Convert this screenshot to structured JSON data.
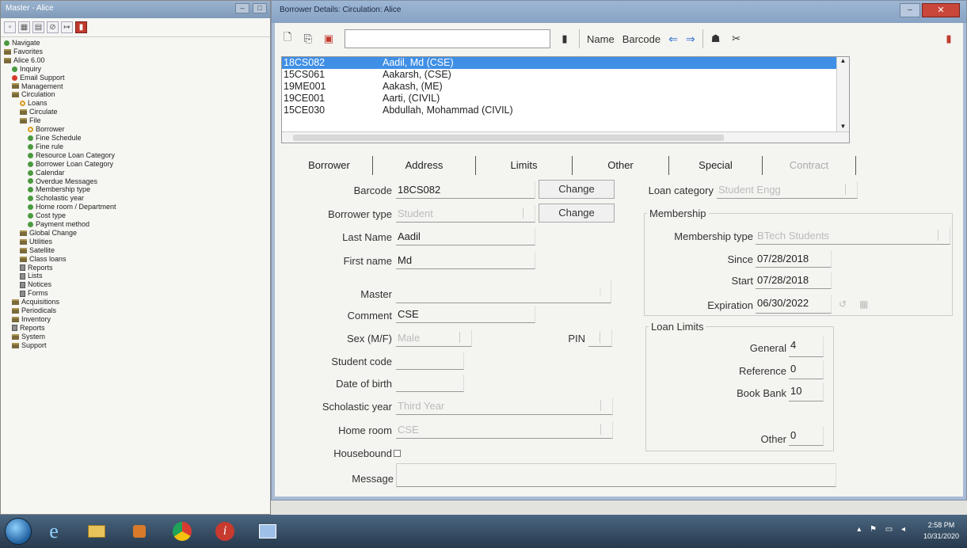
{
  "master": {
    "title": "Master - Alice",
    "tree": [
      {
        "label": "Navigate",
        "icon": "green",
        "level": 0
      },
      {
        "label": "Favorites",
        "icon": "folder",
        "level": 0
      },
      {
        "label": "Alice 6.00",
        "icon": "folder",
        "level": 0
      },
      {
        "label": "Inquiry",
        "icon": "green",
        "level": 1
      },
      {
        "label": "Email Support",
        "icon": "red",
        "level": 1
      },
      {
        "label": "Management",
        "icon": "folder",
        "level": 1
      },
      {
        "label": "Circulation",
        "icon": "folder",
        "level": 1
      },
      {
        "label": "Loans",
        "icon": "ring",
        "level": 2
      },
      {
        "label": "Circulate",
        "icon": "folder",
        "level": 2
      },
      {
        "label": "File",
        "icon": "folder",
        "level": 2
      },
      {
        "label": "Borrower",
        "icon": "ring",
        "level": 3
      },
      {
        "label": "Fine Schedule",
        "icon": "green",
        "level": 3
      },
      {
        "label": "Fine rule",
        "icon": "green",
        "level": 3
      },
      {
        "label": "Resource Loan Category",
        "icon": "green",
        "level": 3
      },
      {
        "label": "Borrower Loan Category",
        "icon": "green",
        "level": 3
      },
      {
        "label": "Calendar",
        "icon": "green",
        "level": 3
      },
      {
        "label": "Overdue Messages",
        "icon": "green",
        "level": 3
      },
      {
        "label": "Membership type",
        "icon": "green",
        "level": 3
      },
      {
        "label": "Scholastic year",
        "icon": "green",
        "level": 3
      },
      {
        "label": "Home room / Department",
        "icon": "green",
        "level": 3
      },
      {
        "label": "Cost type",
        "icon": "green",
        "level": 3
      },
      {
        "label": "Payment method",
        "icon": "green",
        "level": 3
      },
      {
        "label": "Global Change",
        "icon": "folder",
        "level": 2
      },
      {
        "label": "Utilities",
        "icon": "folder",
        "level": 2
      },
      {
        "label": "Satellite",
        "icon": "folder",
        "level": 2
      },
      {
        "label": "Class loans",
        "icon": "folder",
        "level": 2
      },
      {
        "label": "Reports",
        "icon": "doc",
        "level": 2
      },
      {
        "label": "Lists",
        "icon": "doc",
        "level": 2
      },
      {
        "label": "Notices",
        "icon": "doc",
        "level": 2
      },
      {
        "label": "Forms",
        "icon": "doc",
        "level": 2
      },
      {
        "label": "Acquisitions",
        "icon": "folder",
        "level": 1
      },
      {
        "label": "Periodicals",
        "icon": "folder",
        "level": 1
      },
      {
        "label": "Inventory",
        "icon": "folder",
        "level": 1
      },
      {
        "label": "Reports",
        "icon": "doc",
        "level": 1
      },
      {
        "label": "System",
        "icon": "folder",
        "level": 1
      },
      {
        "label": "Support",
        "icon": "folder",
        "level": 1
      }
    ]
  },
  "borrower_window": {
    "title": "Borrower Details: Circulation: Alice",
    "toolbar": {
      "name_label": "Name",
      "barcode_label": "Barcode",
      "search_value": ""
    },
    "list": [
      {
        "barcode": "18CS082",
        "name": "Aadil, Md (CSE)",
        "selected": true
      },
      {
        "barcode": "15CS061",
        "name": "Aakarsh, (CSE)",
        "selected": false
      },
      {
        "barcode": "19ME001",
        "name": "Aakash, (ME)",
        "selected": false
      },
      {
        "barcode": "19CE001",
        "name": "Aarti, (CIVIL)",
        "selected": false
      },
      {
        "barcode": "15CE030",
        "name": "Abdullah, Mohammad (CIVIL)",
        "selected": false
      }
    ],
    "tabs": [
      "Borrower",
      "Address",
      "Limits",
      "Other",
      "Special",
      "Contract"
    ],
    "form": {
      "barcode_label": "Barcode",
      "barcode": "18CS082",
      "change_label": "Change",
      "borrower_type_label": "Borrower type",
      "borrower_type": "Student",
      "last_name_label": "Last Name",
      "last_name": "Aadil",
      "first_name_label": "First name",
      "first_name": "Md",
      "master_label": "Master",
      "master": "",
      "comment_label": "Comment",
      "comment": "CSE",
      "sex_label": "Sex (M/F)",
      "sex": "Male",
      "pin_label": "PIN",
      "student_code_label": "Student code",
      "student_code": "",
      "dob_label": "Date of birth",
      "dob": "",
      "scholastic_year_label": "Scholastic year",
      "scholastic_year": "Third Year",
      "home_room_label": "Home room",
      "home_room": "CSE",
      "housebound_label": "Housebound",
      "message_label": "Message",
      "message": ""
    },
    "loan_category_label": "Loan category",
    "loan_category": "Student Engg",
    "membership": {
      "title": "Membership",
      "type_label": "Membership type",
      "type": "BTech Students",
      "since_label": "Since",
      "since": "07/28/2018",
      "start_label": "Start",
      "start": "07/28/2018",
      "expiration_label": "Expiration",
      "expiration": "06/30/2022"
    },
    "loan_limits": {
      "title": "Loan Limits",
      "general_label": "General",
      "general": "4",
      "reference_label": "Reference",
      "reference": "0",
      "book_bank_label": "Book Bank",
      "book_bank": "10",
      "other_label": "Other",
      "other": "0"
    }
  },
  "taskbar": {
    "time": "2:58 PM",
    "date": "10/31/2020"
  }
}
